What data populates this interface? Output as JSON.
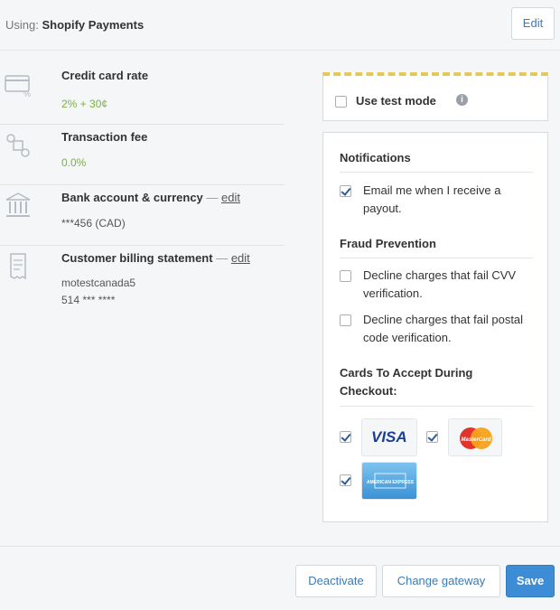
{
  "header": {
    "using_prefix": "Using:",
    "gateway_name": "Shopify Payments",
    "edit_label": "Edit"
  },
  "rows": [
    {
      "title": "Credit card rate",
      "value": "2% + 30¢"
    },
    {
      "title": "Transaction fee",
      "value": "0.0%"
    },
    {
      "title": "Bank account & currency",
      "dash": "—",
      "link": "edit",
      "value": "***456 (CAD)"
    },
    {
      "title": "Customer billing statement",
      "dash": "—",
      "link": "edit",
      "value": "motestcanada5",
      "value2": "514 *** ****"
    }
  ],
  "test_mode": {
    "label": "Use test mode",
    "checked": false
  },
  "notifications": {
    "heading": "Notifications",
    "email_payout": "Email me when I receive a payout.",
    "email_payout_checked": true
  },
  "fraud": {
    "heading": "Fraud Prevention",
    "cvv": "Decline charges that fail CVV verification.",
    "cvv_checked": false,
    "postal": "Decline charges that fail postal code verification.",
    "postal_checked": false
  },
  "cards": {
    "heading": "Cards To Accept During Checkout:",
    "visa": {
      "label": "VISA",
      "checked": true
    },
    "mastercard": {
      "label": "MasterCard",
      "checked": true
    },
    "amex": {
      "label": "AMERICAN EXPRESS",
      "checked": true
    }
  },
  "footer": {
    "deactivate": "Deactivate",
    "change_gateway": "Change gateway",
    "save": "Save"
  },
  "colors": {
    "accent": "#3c8dd6",
    "green": "#7ab33f",
    "link": "#3a7bb6"
  }
}
